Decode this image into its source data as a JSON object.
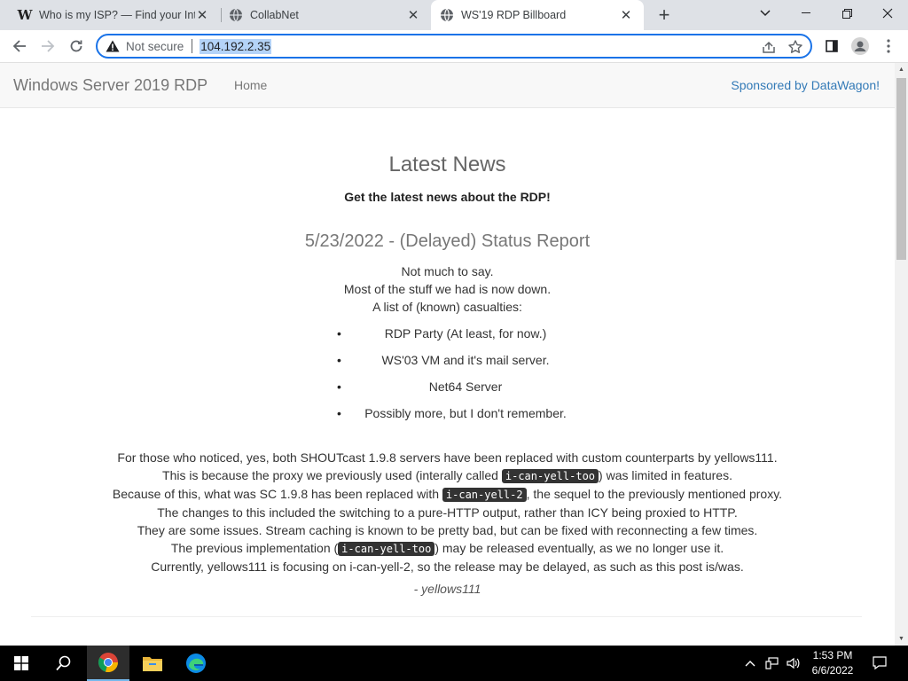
{
  "browser": {
    "tabs": [
      {
        "title": "Who is my ISP? — Find your Inte",
        "icon": "w-favicon"
      },
      {
        "title": "CollabNet",
        "icon": "globe-icon"
      },
      {
        "title": "WS'19 RDP Billboard",
        "icon": "globe-icon",
        "active": true
      }
    ],
    "new_tab_symbol": "+",
    "security_label": "Not secure",
    "url": "104.192.2.35"
  },
  "page": {
    "brand": "Windows Server 2019 RDP",
    "nav_home": "Home",
    "sponsor_prefix": "Sponsored by ",
    "sponsor_link": "DataWagon",
    "sponsor_suffix": "!",
    "heading": "Latest News",
    "subheading": "Get the latest news about the RDP!",
    "post": {
      "title": "5/23/2022 - (Delayed) Status Report",
      "intro": [
        "Not much to say.",
        "Most of the stuff we had is now down.",
        "A list of (known) casualties:"
      ],
      "casualties": [
        "RDP Party (At least, for now.)",
        "WS'03 VM and it's mail server.",
        "Net64 Server",
        "Possibly more, but I don't remember."
      ],
      "body": {
        "l1": "For those who noticed, yes, both SHOUTcast 1.9.8 servers have been replaced with custom counterparts by yellows111.",
        "l2_a": "This is because the proxy we previously used (interally called ",
        "l2_code": "i-can-yell-too",
        "l2_b": ") was limited in features.",
        "l3_a": "Because of this, what was SC 1.9.8 has been replaced with ",
        "l3_code": "i-can-yell-2",
        "l3_b": ", the sequel to the previously mentioned proxy.",
        "l4": "The changes to this included the switching to a pure-HTTP output, rather than ICY being proxied to HTTP.",
        "l5": "They are some issues. Stream caching is known to be pretty bad, but can be fixed with reconnecting a few times.",
        "l6_a": "The previous implementation (",
        "l6_code": "i-can-yell-too",
        "l6_b": ") may be released eventually, as we no longer use it.",
        "l7": "Currently, yellows111 is focusing on i-can-yell-2, so the release may be delayed, as such as this post is/was."
      },
      "signature": "- yellows111"
    }
  },
  "taskbar": {
    "time": "1:53 PM",
    "date": "6/6/2022"
  },
  "colors": {
    "accent": "#1a73e8",
    "link": "#337ab7",
    "navbar_bg": "#f8f8f8",
    "code_bg": "#333333"
  }
}
